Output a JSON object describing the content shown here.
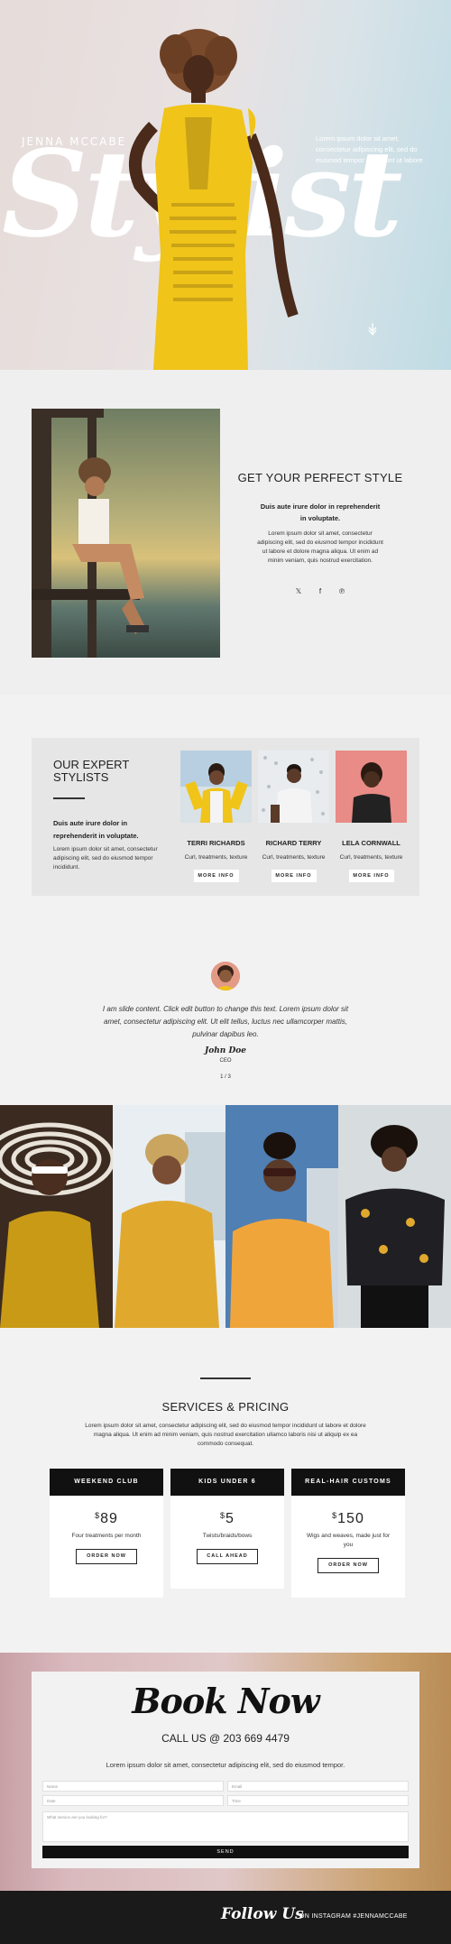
{
  "hero": {
    "name": "JENNA MCCABE",
    "script": "Stylist",
    "tagline": "Lorem ipsum dolor sit amet, consectetur adipiscing elit, sed do eiusmod tempor incididunt ut labore",
    "scroll_icon": "arrow-down-icon"
  },
  "perfect": {
    "title": "GET YOUR PERFECT STYLE",
    "bold": "Duis aute irure dolor in reprehenderit in voluptate.",
    "body": "Lorem ipsum dolor sit amet, consectetur adipiscing elit, sed do eiusmod tempor incididunt ut labore et dolore magna aliqua. Ut enim ad minim veniam, quis nostrud exercitation.",
    "social": [
      "twitter-icon",
      "facebook-icon",
      "pinterest-icon"
    ],
    "social_glyphs": [
      "𝕏",
      "f",
      "℗"
    ]
  },
  "experts": {
    "title": "OUR EXPERT STYLISTS",
    "bold": "Duis aute irure dolor in reprehenderit in voluptate.",
    "body": "Lorem ipsum dolor sit amet, consectetur adipiscing elit, sed do eiusmod tempor incididunt.",
    "stylists": [
      {
        "name": "TERRI RICHARDS",
        "desc": "Curl, treatments, texture",
        "button": "MORE INFO"
      },
      {
        "name": "RICHARD TERRY",
        "desc": "Curl, treatments, texture",
        "button": "MORE INFO"
      },
      {
        "name": "LELA CORNWALL",
        "desc": "Curl, treatments, texture",
        "button": "MORE INFO"
      }
    ]
  },
  "testimonial": {
    "quote": "I am slide content. Click edit button to change this text. Lorem ipsum dolor sit amet, consectetur adipiscing elit. Ut elit tellus, luctus nec ullamcorper mattis, pulvinar dapibus leo.",
    "signature": "John Doe",
    "role": "CEO",
    "counter": "1 / 3"
  },
  "services": {
    "title": "SERVICES & PRICING",
    "text": "Lorem ipsum dolor sit amet, consectetur adipiscing elit, sed do eiusmod tempor incididunt ut labore et dolore magna aliqua. Ut enim ad minim veniam, quis nostrud exercitation ullamco laboris nisi ut aliquip ex ea commodo consequat.",
    "cards": [
      {
        "header": "WEEKEND CLUB",
        "price": "89",
        "desc": "Four treatments per month",
        "button": "ORDER NOW"
      },
      {
        "header": "KIDS UNDER 6",
        "price": "5",
        "desc": "Twists/braids/bows",
        "button": "CALL AHEAD"
      },
      {
        "header": "REAL-HAIR CUSTOMS",
        "price": "150",
        "desc": "Wigs and weaves, made just for you",
        "button": "ORDER NOW"
      }
    ],
    "currency": "$"
  },
  "booking": {
    "title": "Book Now",
    "phone": "CALL US @ 203 669 4479",
    "text": "Lorem ipsum dolor sit amet, consectetur adipiscing elit, sed do eiusmod tempor.",
    "name_placeholder": "Name",
    "email_placeholder": "Email",
    "date_placeholder": "Date",
    "time_placeholder": "Time",
    "message_placeholder": "What service are you looking for?",
    "send": "SEND"
  },
  "footer": {
    "follow": "Follow Us",
    "instagram": "ON INSTAGRAM #JENNAMCCABE"
  },
  "colors": {
    "accent_yellow": "#f0c419",
    "dark": "#111111"
  }
}
